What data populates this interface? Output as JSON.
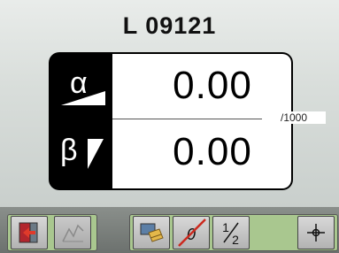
{
  "header": {
    "title": "L 09121"
  },
  "readings": {
    "alpha": {
      "symbol": "α",
      "value": "0.00"
    },
    "beta": {
      "symbol": "β",
      "value": "0.00"
    },
    "unit": "/1000"
  },
  "toolbar": {
    "zero_label": "0",
    "half_label_num": "1",
    "half_label_den": "2",
    "icons": [
      "exit-icon",
      "graph-icon",
      "pencil-hand-icon",
      "zero-icon",
      "half-icon",
      "crosshair-icon"
    ]
  },
  "colors": {
    "panel": "#000000",
    "toolbar_group": "#a9c78f",
    "accent_red": "#cc2a1f"
  }
}
